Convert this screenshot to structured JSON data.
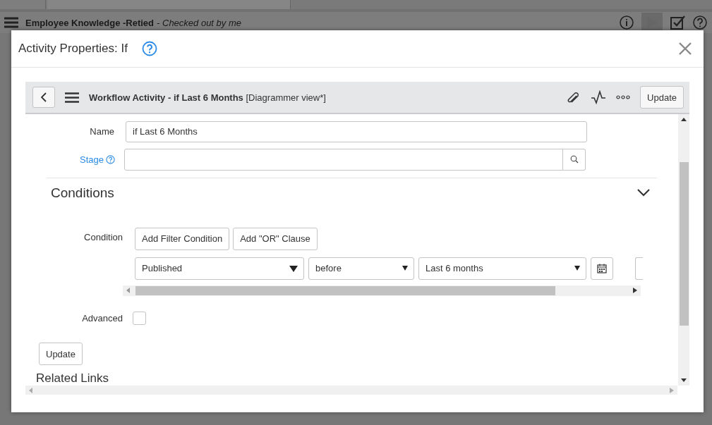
{
  "app": {
    "title": "Employee Knowledge -Retied",
    "status": "- Checked out by me"
  },
  "dialog": {
    "title": "Activity Properties: If",
    "form": {
      "title": "Workflow Activity - if Last 6 Months",
      "view": "[Diagrammer view*]",
      "update_button": "Update"
    },
    "name_field": {
      "label": "Name",
      "value": "if Last 6 Months"
    },
    "stage_field": {
      "label": "Stage"
    },
    "section": {
      "title": "Conditions",
      "expanded": true
    },
    "condition": {
      "label": "Condition",
      "buttons": [
        "Add Filter Condition",
        "Add \"OR\" Clause"
      ],
      "field": "Published",
      "operator": "before",
      "value": "Last 6 months"
    },
    "advanced": {
      "label": "Advanced",
      "checked": false
    },
    "update_button": "Update",
    "related_links": "Related Links"
  }
}
